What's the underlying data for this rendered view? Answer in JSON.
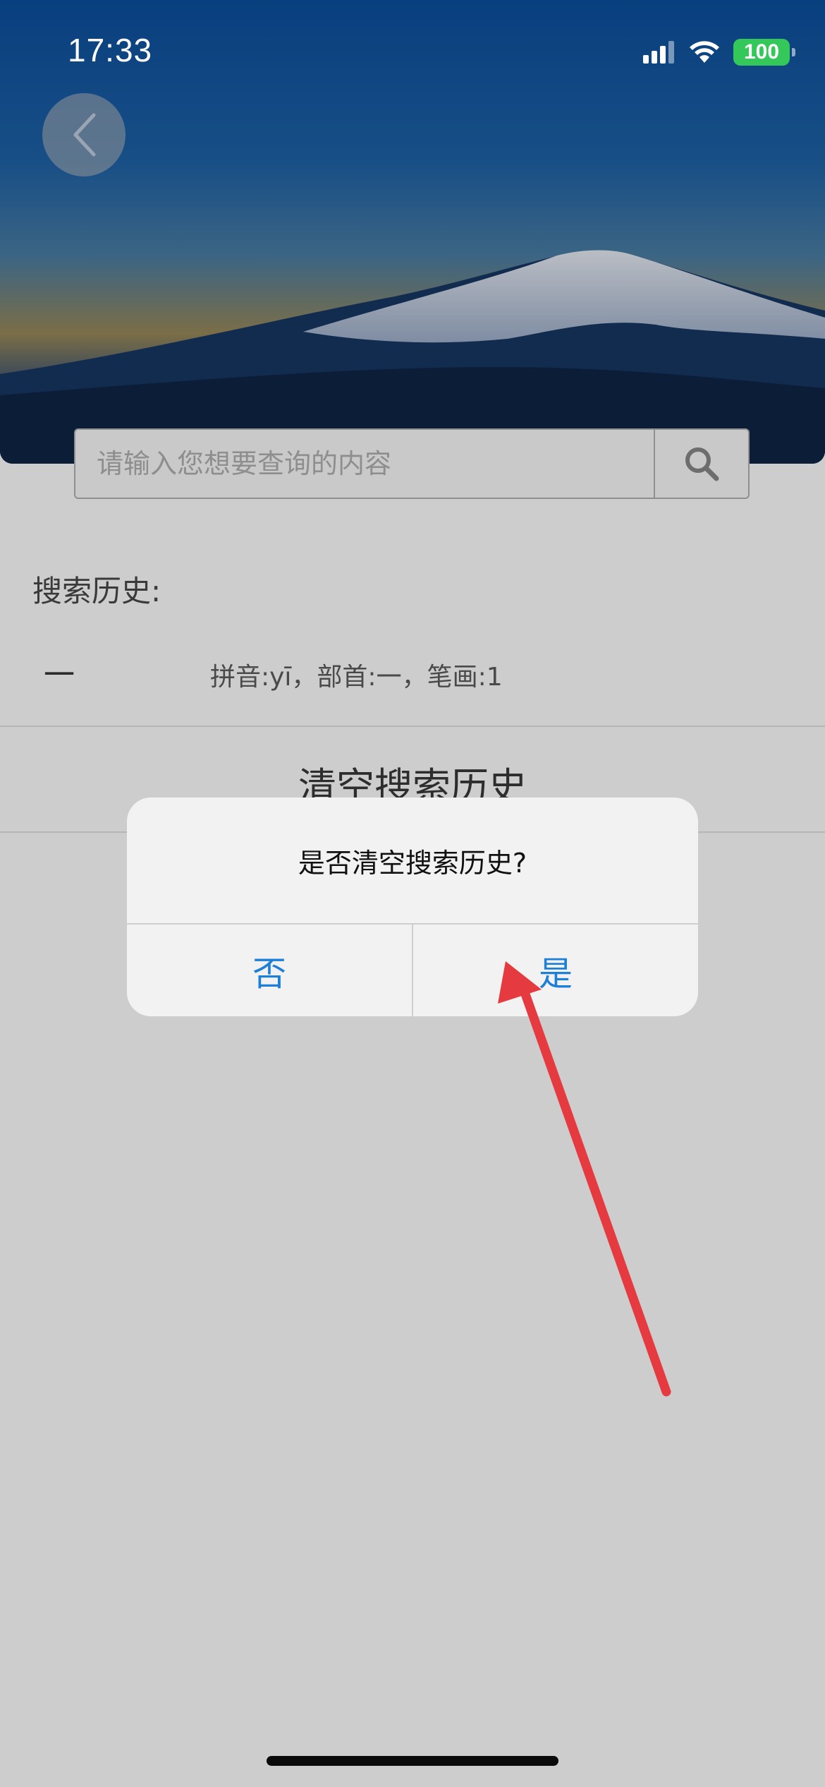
{
  "status_bar": {
    "time": "17:33",
    "battery": "100"
  },
  "search": {
    "placeholder": "请输入您想要查询的内容"
  },
  "history": {
    "title": "搜索历史:",
    "items": [
      {
        "char": "一",
        "info": "拼音:yī，部首:一，笔画:1"
      }
    ],
    "clear_label": "清空搜索历史"
  },
  "dialog": {
    "message": "是否清空搜索历史?",
    "no_label": "否",
    "yes_label": "是"
  },
  "colors": {
    "accent": "#1e7fd6",
    "battery": "#34c759",
    "annotation_arrow": "#e53a3f"
  }
}
